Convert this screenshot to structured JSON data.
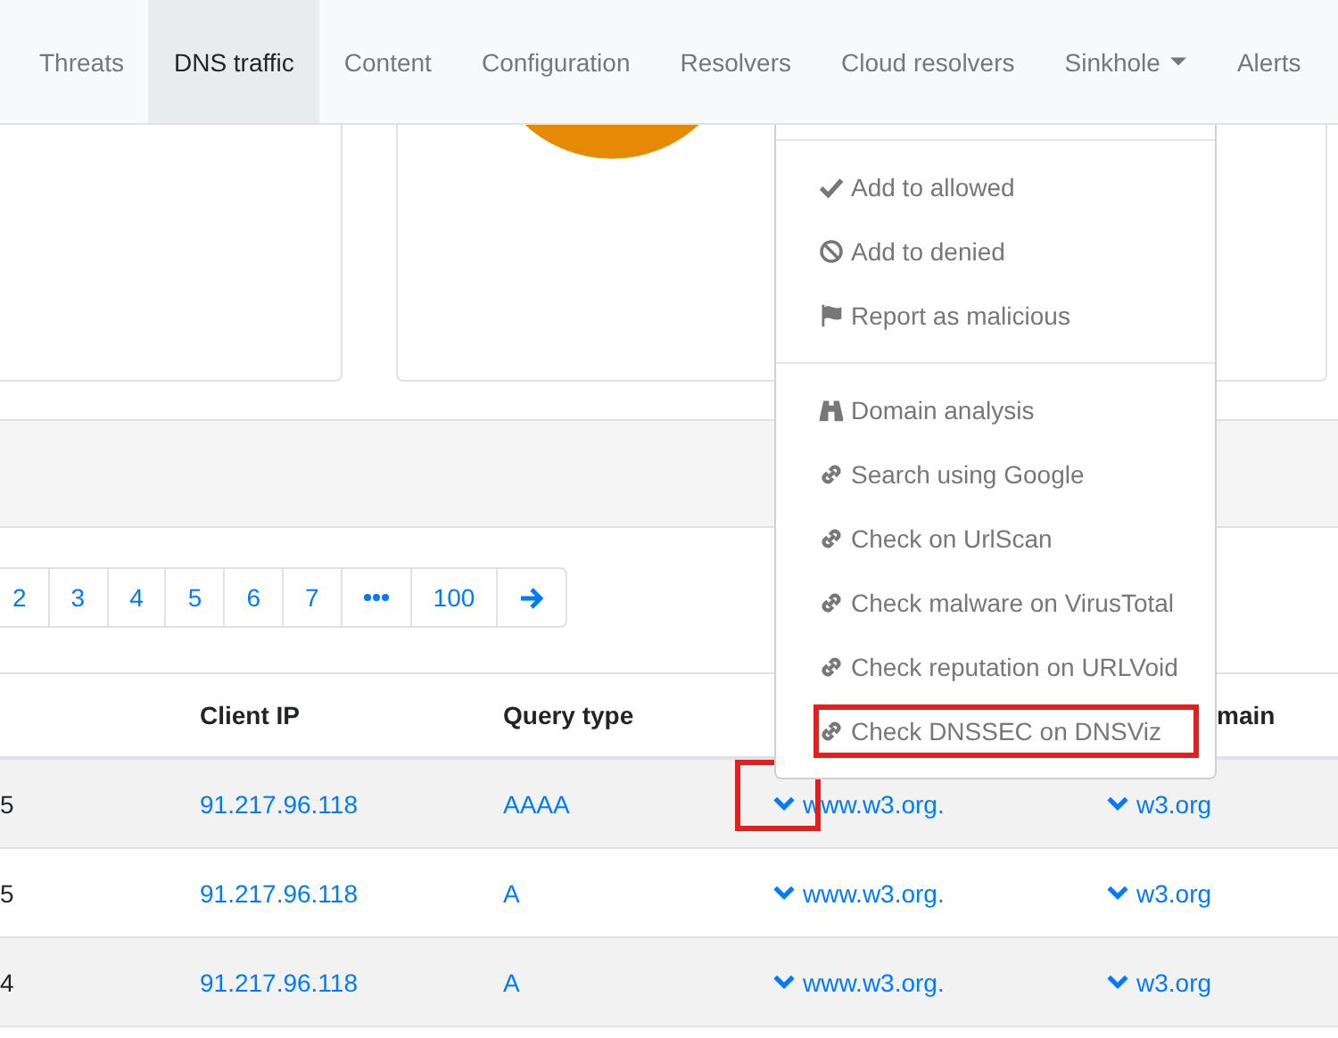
{
  "nav": {
    "items": [
      {
        "label": "Threats",
        "selected": false,
        "dropdown": false
      },
      {
        "label": "DNS traffic",
        "selected": true,
        "dropdown": false
      },
      {
        "label": "Content",
        "selected": false,
        "dropdown": false
      },
      {
        "label": "Configuration",
        "selected": false,
        "dropdown": false
      },
      {
        "label": "Resolvers",
        "selected": false,
        "dropdown": false
      },
      {
        "label": "Cloud resolvers",
        "selected": false,
        "dropdown": false
      },
      {
        "label": "Sinkhole",
        "selected": false,
        "dropdown": true
      },
      {
        "label": "Alerts",
        "selected": false,
        "dropdown": false
      }
    ]
  },
  "pagination": [
    {
      "kind": "page",
      "label": "2"
    },
    {
      "kind": "page",
      "label": "3"
    },
    {
      "kind": "page",
      "label": "4"
    },
    {
      "kind": "page",
      "label": "5"
    },
    {
      "kind": "page",
      "label": "6"
    },
    {
      "kind": "page",
      "label": "7"
    },
    {
      "kind": "ellipsis"
    },
    {
      "kind": "page",
      "label": "100"
    },
    {
      "kind": "next"
    }
  ],
  "table": {
    "header": {
      "column_2": "Client IP",
      "column_3": "Query type",
      "column_5": "main"
    },
    "rows": [
      {
        "column_1": "5",
        "client_ip": "91.217.96.118",
        "query_type": "AAAA",
        "domain": "www.w3.org.",
        "column_5": "w3.org",
        "chevron_highlighted": true
      },
      {
        "column_1": "5",
        "client_ip": "91.217.96.118",
        "query_type": "A",
        "domain": "www.w3.org.",
        "column_5": "w3.org",
        "chevron_highlighted": false
      },
      {
        "column_1": "4",
        "client_ip": "91.217.96.118",
        "query_type": "A",
        "domain": "www.w3.org.",
        "column_5": "w3.org",
        "chevron_highlighted": false
      }
    ]
  },
  "menu": {
    "groups": [
      [
        {
          "kind": "check",
          "label": "Add to allowed",
          "highlighted": false
        },
        {
          "kind": "ban",
          "label": "Add to denied",
          "highlighted": false
        },
        {
          "kind": "flag",
          "label": "Report as malicious",
          "highlighted": false
        }
      ],
      [
        {
          "kind": "binoculars",
          "label": "Domain analysis",
          "highlighted": false
        },
        {
          "kind": "link",
          "label": "Search using Google",
          "highlighted": false
        },
        {
          "kind": "link",
          "label": "Check on UrlScan",
          "highlighted": false
        },
        {
          "kind": "link",
          "label": "Check malware on VirusTotal",
          "highlighted": false
        },
        {
          "kind": "link",
          "label": "Check reputation on URLVoid",
          "highlighted": false
        },
        {
          "kind": "link",
          "label": "Check DNSSEC on DNSViz",
          "highlighted": true
        }
      ]
    ]
  }
}
